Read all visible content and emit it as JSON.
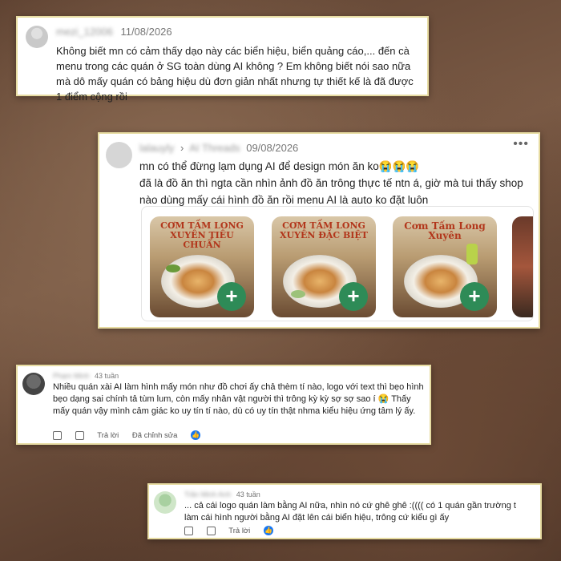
{
  "comments": [
    {
      "author": "mezi_12006",
      "date": "11/08/2026",
      "text": "Không biết mn có cảm thấy dạo này các biển hiệu, biển quảng cáo,... đến cà menu trong các quán ở SG toàn dùng AI không ? Em không biết nói sao nữa mà dô mấy quán có bảng hiệu dù đơn giản nhất nhưng tự thiết kế là đã được 1 điểm cộng rồi"
    },
    {
      "author": "lalauyly",
      "thread": "AI Threads",
      "date": "09/08/2026",
      "more_icon": "ellipsis-icon",
      "line1": "mn có thể đừng lạm dụng AI để design món ăn ko😭😭😭",
      "line2": "đã là đồ ăn thì ngta cần nhìn ảnh đồ ăn trông thực tế ntn á, giờ mà tui thấy shop nào dùng mấy cái hình đồ ăn rồi menu AI là auto ko đặt luôn",
      "foods": [
        {
          "title": "CƠM TẤM LONG XUYÊN TIÊU CHUẨN",
          "add": "+"
        },
        {
          "title": "CƠM TẤM LONG XUYÊN ĐẶC BIỆT",
          "add": "+"
        },
        {
          "title": "Cơm Tấm Long Xuyên",
          "add": "+"
        }
      ]
    },
    {
      "author": "Phạm Minh",
      "time": "43 tuần",
      "text": "Nhiều quán xài AI làm hình mấy món như đồ chơi ấy chả thèm tí nào, logo với text thì bẹo hình bẹo dạng sai chính tả tùm lum, còn mấy nhân vật người thì trông kỳ kỳ sợ sợ sao í 😭 Thấy mấy quán vậy mình cảm giác ko uy tín tí nào, dù có uy tín thật nhma kiểu hiệu ứng tâm lý ấy.",
      "reply": "Trả lời",
      "edited": "Đã chỉnh sửa"
    },
    {
      "author": "Trần Minh Anh",
      "time": "43 tuần",
      "text1": "... cả cái logo quán làm bằng AI nữa, nhìn nó cứ ghê ghê :(((( có 1 quán gần trường t",
      "text2": "làm cái hình người bằng AI đặt lên cái biển hiệu, trông cứ kiểu gì ấy",
      "reply": "Trả lời"
    }
  ],
  "colors": {
    "accent_green": "#2e8b57",
    "card_border": "#e7dca2",
    "like_blue": "#1877f2"
  }
}
